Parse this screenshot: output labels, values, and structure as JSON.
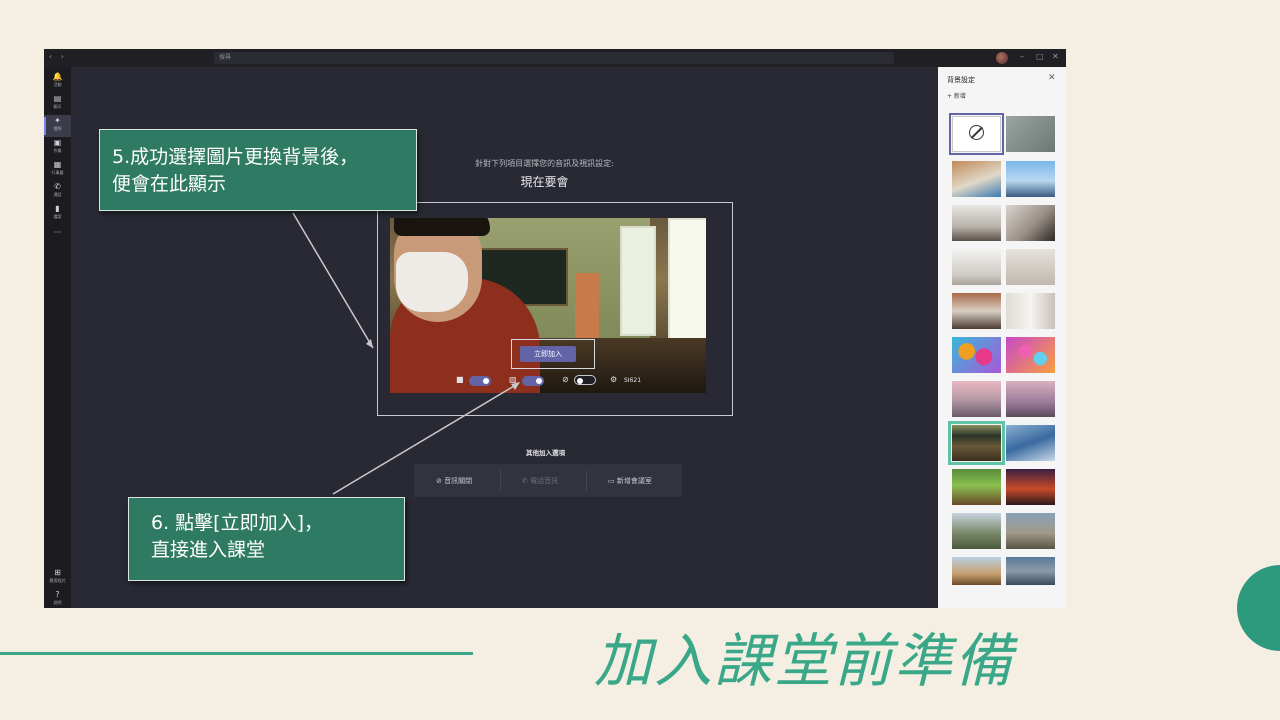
{
  "slide": {
    "title": "加入課堂前準備"
  },
  "callouts": {
    "step5_line1": "5.成功選擇圖片更換背景後，",
    "step5_line2": "便會在此顯示",
    "step6_line1": "6. 點擊[立即加入]，",
    "step6_line2": "直接進入課堂"
  },
  "titlebar": {
    "nav": "‹ ›",
    "search_placeholder": "搜尋",
    "controls": [
      "–",
      "▢",
      "✕"
    ]
  },
  "rail": {
    "items": [
      {
        "icon": "bell-icon",
        "glyph": "🔔",
        "label": "活動"
      },
      {
        "icon": "chat-icon",
        "glyph": "▤",
        "label": "聊天"
      },
      {
        "icon": "teams-icon",
        "glyph": "✦",
        "label": "團隊",
        "active": true
      },
      {
        "icon": "assignments-icon",
        "glyph": "▣",
        "label": "作業"
      },
      {
        "icon": "calendar-icon",
        "glyph": "▦",
        "label": "行事曆"
      },
      {
        "icon": "phone-icon",
        "glyph": "✆",
        "label": "通話"
      },
      {
        "icon": "files-icon",
        "glyph": "▮",
        "label": "檔案"
      },
      {
        "icon": "more-icon",
        "glyph": "···",
        "label": ""
      }
    ],
    "bottom": [
      {
        "icon": "apps-icon",
        "glyph": "⊞",
        "label": "應用程式"
      },
      {
        "icon": "help-icon",
        "glyph": "?",
        "label": "說明"
      }
    ]
  },
  "join": {
    "subtitle": "針對下列項目選擇您的音訊及視訊設定:",
    "title": "現在要會",
    "join_button": "立即加入",
    "device_label": "SI621"
  },
  "other_options": {
    "title": "其他加入選項",
    "audio_off": "音訊關閉",
    "phone_audio": "電話音訊",
    "add_room": "新增會議室"
  },
  "background_panel": {
    "title": "背景設定",
    "add_new": "+ 新增",
    "close": "✕"
  },
  "colors": {
    "accent": "#6264a7",
    "callout": "#2e7a62",
    "slide_green": "#3aa888",
    "slide_bg": "#f4efe2"
  }
}
